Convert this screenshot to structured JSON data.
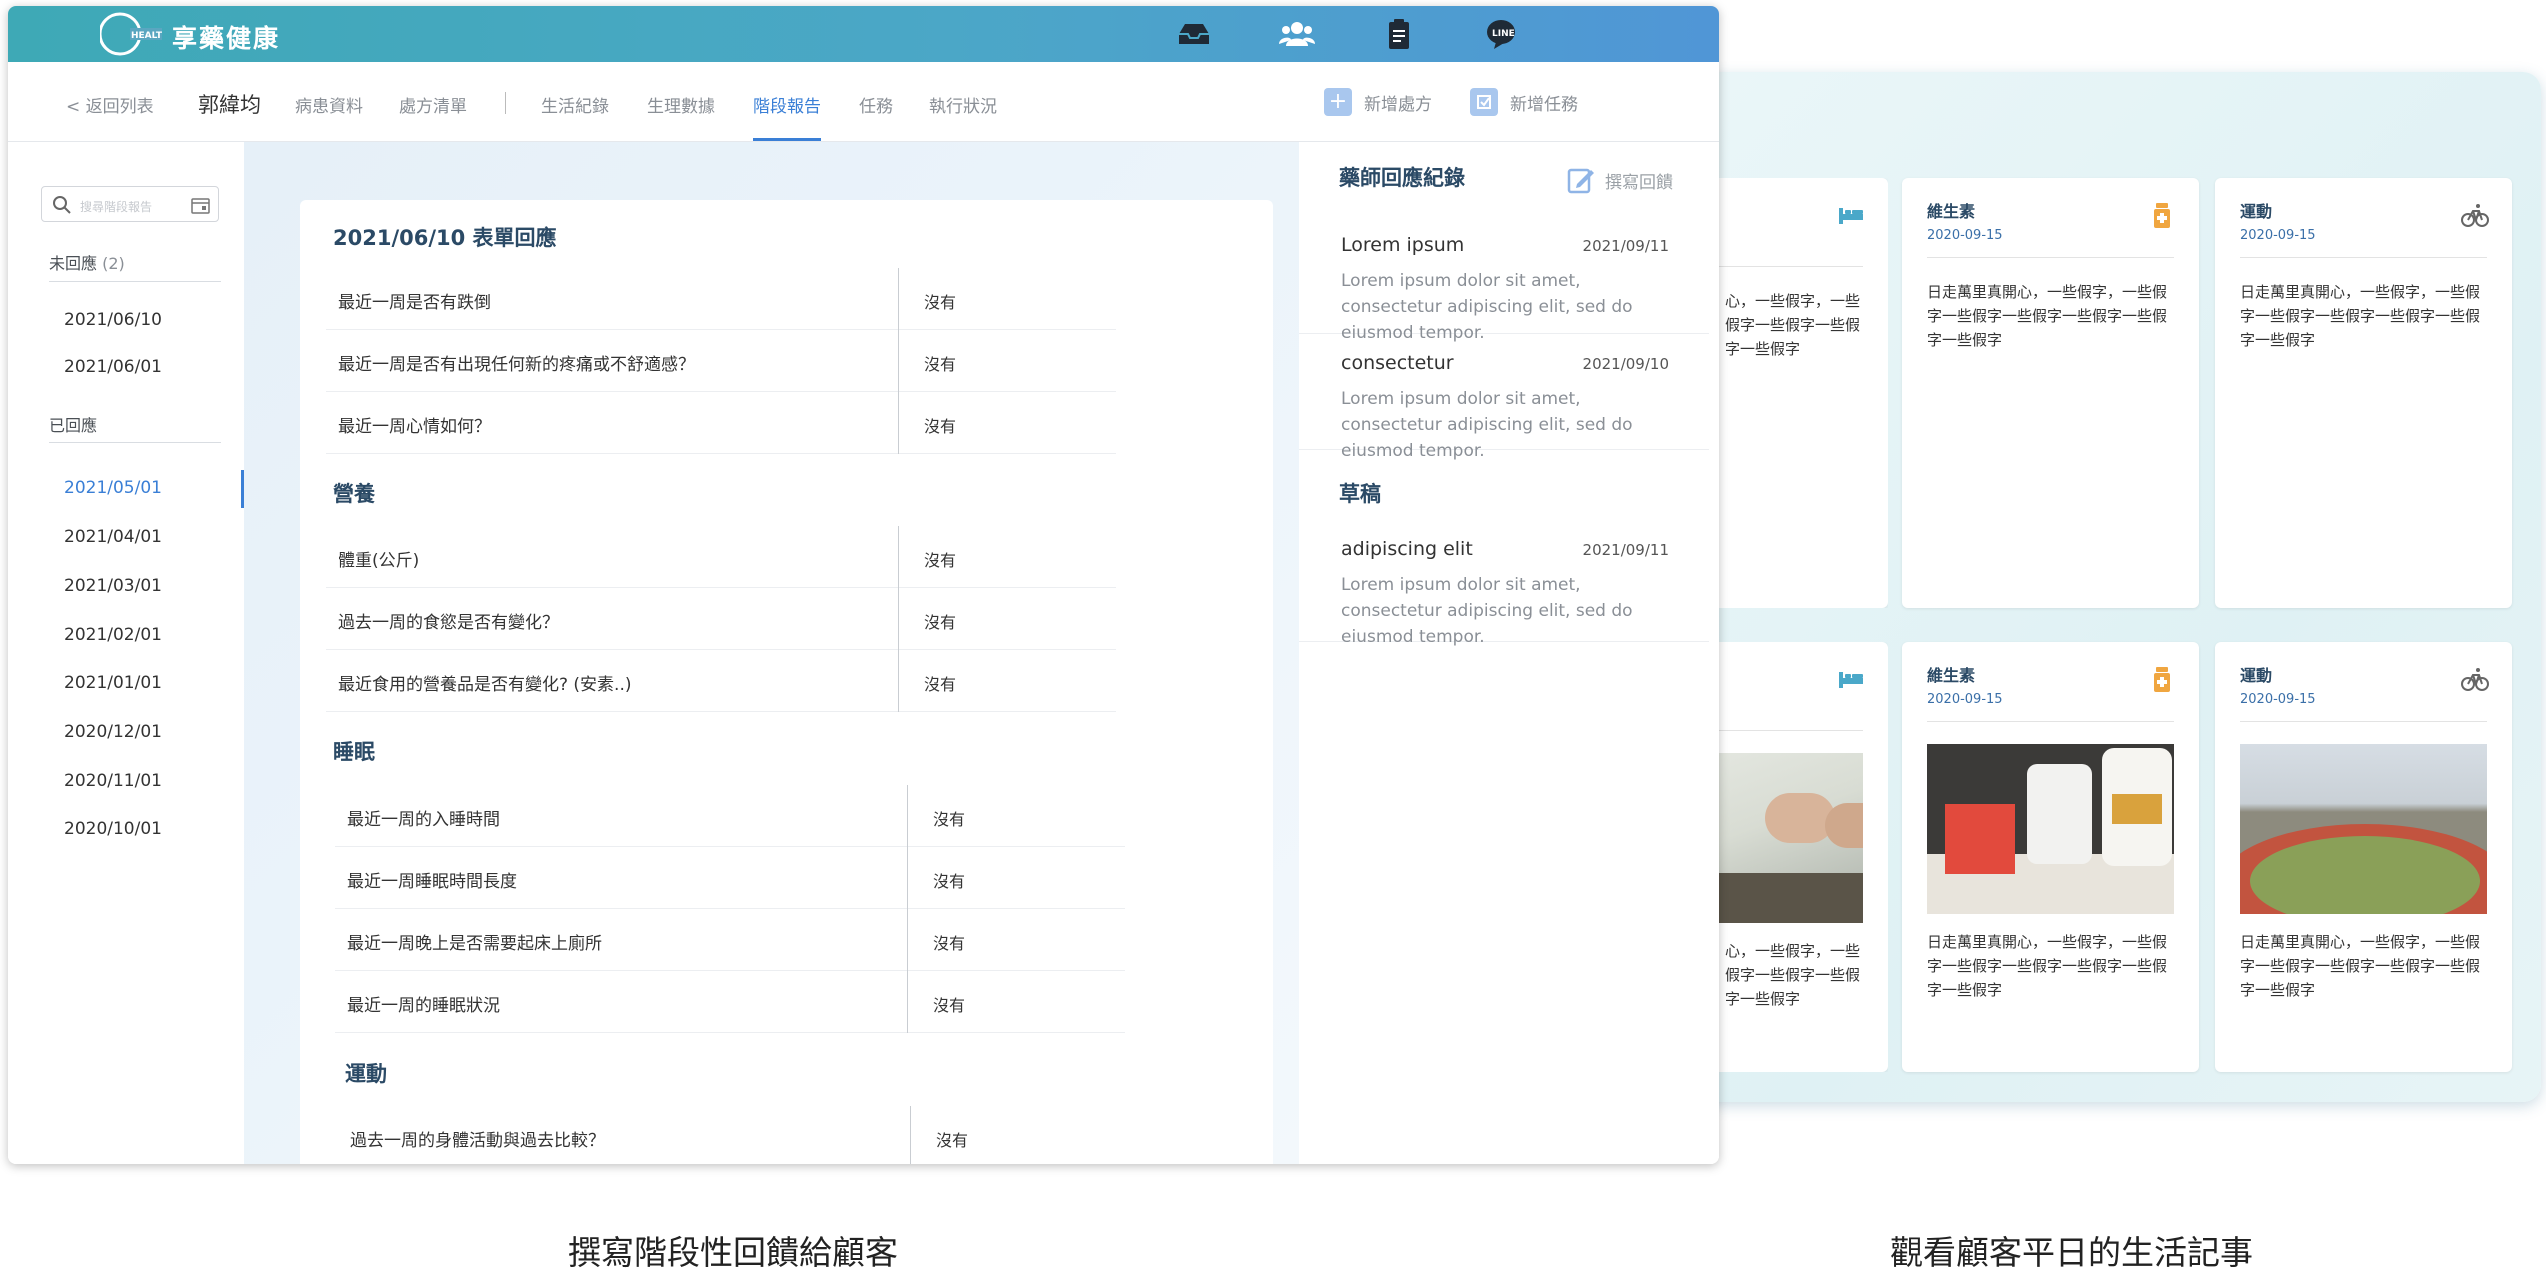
{
  "app": {
    "brand": "享藥健康",
    "logo_text": "HEALTH",
    "top_icons": [
      "inbox-icon",
      "users-icon",
      "clipboard-icon",
      "line-chat-icon"
    ]
  },
  "nav": {
    "back": "< 返回列表",
    "patient_name": "郭緯均",
    "tabs": [
      "病患資料",
      "處方清單",
      "生活紀錄",
      "生理數據",
      "階段報告",
      "任務",
      "執行狀況"
    ],
    "active_tab": "階段報告",
    "add_prescription": "新增處方",
    "add_task": "新增任務"
  },
  "sidebar": {
    "search_placeholder": "搜尋階段報告",
    "unanswered_label": "未回應",
    "unanswered_count": "(2)",
    "unanswered": [
      "2021/06/10",
      "2021/06/01"
    ],
    "answered_label": "已回應",
    "answered": [
      "2021/05/01",
      "2021/04/01",
      "2021/03/01",
      "2021/02/01",
      "2021/01/01",
      "2020/12/01",
      "2020/11/01",
      "2020/10/01"
    ],
    "selected": "2021/05/01"
  },
  "form": {
    "title": "2021/06/10 表單回應",
    "general": [
      {
        "q": "最近一周是否有跌倒",
        "a": "沒有"
      },
      {
        "q": "最近一周是否有出現任何新的疼痛或不舒適感？",
        "a": "沒有"
      },
      {
        "q": "最近一周心情如何？",
        "a": "沒有"
      }
    ],
    "nutrition_title": "營養",
    "nutrition": [
      {
        "q": "體重(公斤)",
        "a": "沒有"
      },
      {
        "q": "過去一周的食慾是否有變化？",
        "a": "沒有"
      },
      {
        "q": "最近食用的營養品是否有變化? (安素..)",
        "a": "沒有"
      }
    ],
    "sleep_title": "睡眠",
    "sleep": [
      {
        "q": "最近一周的入睡時間",
        "a": "沒有"
      },
      {
        "q": "最近一周睡眠時間長度",
        "a": "沒有"
      },
      {
        "q": "最近一周晚上是否需要起床上廁所",
        "a": "沒有"
      },
      {
        "q": "最近一周的睡眠狀況",
        "a": "沒有"
      }
    ],
    "exercise_title": "運動",
    "exercise": [
      {
        "q": "過去一周的身體活動與過去比較？",
        "a": "沒有"
      }
    ]
  },
  "pharmacist": {
    "title": "藥師回應紀錄",
    "write_label": "撰寫回饋",
    "records": [
      {
        "name": "Lorem ipsum",
        "date": "2021/09/11",
        "body": "Lorem ipsum dolor sit amet, consectetur adipiscing elit, sed do eiusmod tempor."
      },
      {
        "name": "consectetur",
        "date": "2021/09/10",
        "body": "Lorem ipsum dolor sit amet, consectetur adipiscing elit, sed do eiusmod tempor."
      }
    ],
    "draft_title": "草稿",
    "drafts": [
      {
        "name": "adipiscing elit",
        "date": "2021/09/11",
        "body": "Lorem ipsum dolor sit amet, consectetur adipiscing elit, sed do eiusmod tempor."
      }
    ]
  },
  "life_records": {
    "cards": [
      {
        "title": "",
        "date": "",
        "icon": "bed-icon",
        "text": "心，一些假字，一些假字一些假字一些假字一些假字"
      },
      {
        "title": "維生素",
        "date": "2020-09-15",
        "icon": "pill-bottle-icon",
        "text": "日走萬里真開心，一些假字，一些假字一些假字一些假字一些假字一些假字一些假字"
      },
      {
        "title": "運動",
        "date": "2020-09-15",
        "icon": "bicycle-icon",
        "text": "日走萬里真開心，一些假字，一些假字一些假字一些假字一些假字一些假字一些假字"
      },
      {
        "title": "",
        "date": "",
        "icon": "bed-icon",
        "text": "心，一些假字，一些假字一些假字一些假字一些假字"
      },
      {
        "title": "維生素",
        "date": "2020-09-15",
        "icon": "pill-bottle-icon",
        "text": "日走萬里真開心，一些假字，一些假字一些假字一些假字一些假字一些假字一些假字"
      },
      {
        "title": "運動",
        "date": "2020-09-15",
        "icon": "bicycle-icon",
        "text": "日走萬里真開心，一些假字，一些假字一些假字一些假字一些假字一些假字一些假字"
      }
    ]
  },
  "captions": {
    "left": "撰寫階段性回饋給顧客",
    "right": "觀看顧客平日的生活記事"
  },
  "colors": {
    "accent": "#3a7fd6",
    "topbar_start": "#3ea9b6",
    "topbar_end": "#5096d6",
    "heading": "#2b4a66",
    "vitamin_icon": "#f0a640",
    "bed_icon": "#4aa8c9"
  }
}
